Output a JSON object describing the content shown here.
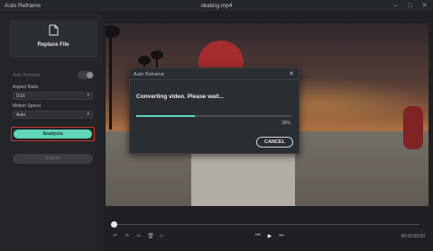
{
  "window": {
    "app_title": "Auto Reframe",
    "file_title": "skating.mp4",
    "controls": [
      "–",
      "□",
      "✕"
    ]
  },
  "sidebar": {
    "replace_file_label": "Replace File",
    "auto_reframe_label": "Auto Reframe",
    "aspect_ratio_label": "Aspect Ratio",
    "aspect_ratio_value": "9:16",
    "motion_speed_label": "Motion Speed",
    "motion_speed_value": "Auto",
    "analysis_button": "Analysis",
    "export_button": "Export"
  },
  "dialog": {
    "title": "Auto Reframe",
    "close_glyph": "✕",
    "message": "Converting video. Please wait...",
    "progress_percent": 38,
    "progress_text": "38%",
    "cancel_button": "CANCEL"
  },
  "timeline": {
    "undo_glyph": "↶",
    "redo_glyph": "↷",
    "cut_glyph": "✂",
    "delete_glyph": "🗑",
    "split_glyph": "⊢",
    "prev_frame_glyph": "⏮",
    "play_glyph": "▶",
    "next_frame_glyph": "⏭",
    "timecode": "00:00:00:00"
  },
  "colors": {
    "accent": "#5fd6b6",
    "highlight_border": "#c9352d"
  }
}
